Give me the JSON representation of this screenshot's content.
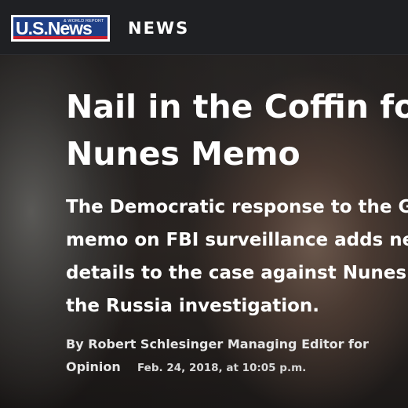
{
  "header": {
    "logo_text": "U.S.News",
    "logo_tagline": "& WORLD REPORT",
    "section": "NEWS"
  },
  "article": {
    "headline_lines": [
      "Nail in the Coffin fo",
      "Nunes Memo"
    ],
    "dek_lines": [
      "The Democratic response to the G",
      "memo on FBI surveillance adds ne",
      "details to the case against Nunes a",
      "the Russia investigation."
    ],
    "byline_line1": "By Robert Schlesinger Managing Editor for",
    "byline_line2": "Opinion",
    "date": "Feb. 24, 2018, at 10:05 p.m."
  },
  "colors": {
    "nav_background": "#1f2023",
    "logo_blue": "#1f3f86",
    "logo_red": "#c8202f",
    "text": "#ffffff"
  }
}
